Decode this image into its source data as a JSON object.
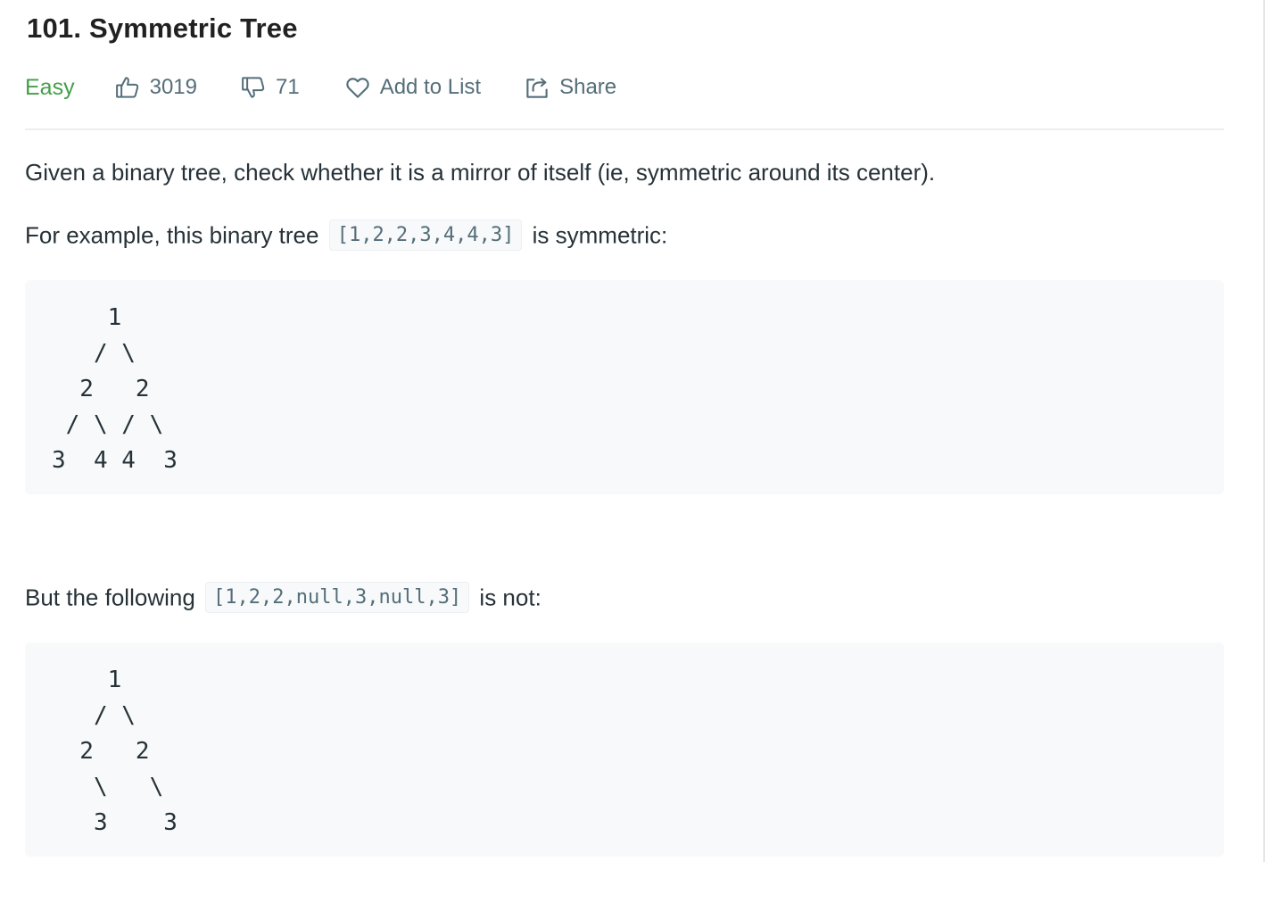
{
  "problem": {
    "title": "101. Symmetric Tree",
    "difficulty": "Easy",
    "likes": "3019",
    "dislikes": "71",
    "add_to_list_label": "Add to List",
    "share_label": "Share"
  },
  "description": {
    "intro": "Given a binary tree, check whether it is a mirror of itself (ie, symmetric around its center).",
    "example1": {
      "prefix": "For example, this binary tree",
      "code": "[1,2,2,3,4,4,3]",
      "suffix": "is symmetric:",
      "tree": "    1\n   / \\\n  2   2\n / \\ / \\\n3  4 4  3"
    },
    "example2": {
      "prefix": "But the following",
      "code": "[1,2,2,null,3,null,3]",
      "suffix": "is not:",
      "tree": "    1\n   / \\\n  2   2\n   \\   \\\n   3    3"
    }
  },
  "colors": {
    "difficulty_easy": "#43a047",
    "meta_text": "#546e7a",
    "body_text": "#263238",
    "code_bg": "#f7f9fa"
  },
  "icons": {
    "like": "thumbs-up-icon",
    "dislike": "thumbs-down-icon",
    "add_to_list": "heart-icon",
    "share": "share-icon"
  }
}
